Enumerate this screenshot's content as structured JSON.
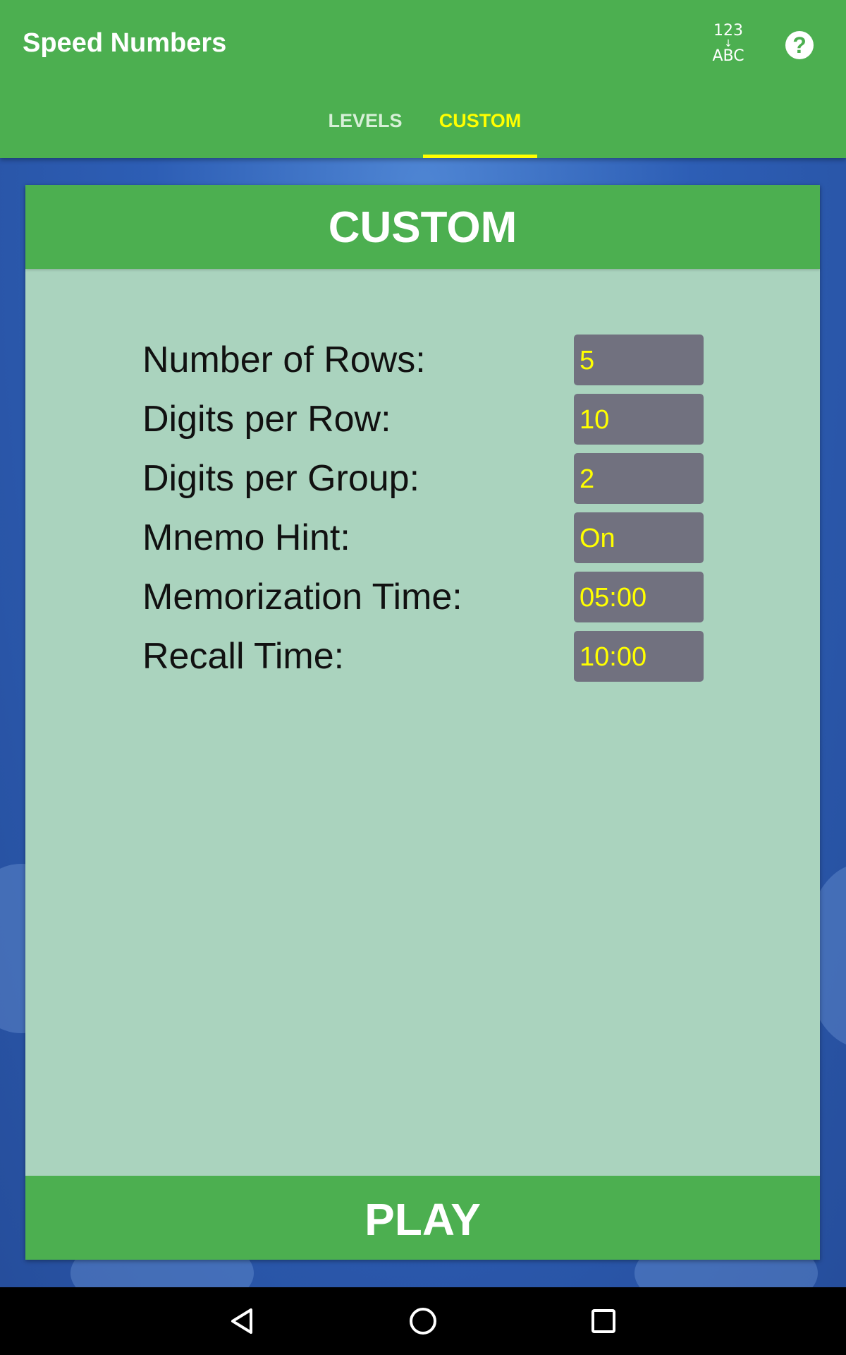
{
  "app": {
    "title": "Speed Numbers"
  },
  "toolbar": {
    "sort_icon": {
      "top": "123",
      "arrow": "↓",
      "bottom": "ABC"
    },
    "help_icon": "?"
  },
  "tabs": [
    {
      "label": "LEVELS",
      "selected": false
    },
    {
      "label": "CUSTOM",
      "selected": true
    }
  ],
  "card": {
    "title": "CUSTOM",
    "settings": [
      {
        "label": "Number of Rows:",
        "value": "5"
      },
      {
        "label": "Digits per Row:",
        "value": "10"
      },
      {
        "label": "Digits per Group:",
        "value": "2"
      },
      {
        "label": "Mnemo Hint:",
        "value": "On"
      },
      {
        "label": "Memorization Time:",
        "value": "05:00"
      },
      {
        "label": "Recall Time:",
        "value": "10:00"
      }
    ],
    "play_label": "PLAY"
  },
  "colors": {
    "appbar": "#4caf50",
    "accent": "#ffff00",
    "card_bg": "#aad3be",
    "field_bg": "#71717f"
  },
  "navbar": {
    "icons": [
      "back-icon",
      "home-icon",
      "recents-icon"
    ]
  }
}
